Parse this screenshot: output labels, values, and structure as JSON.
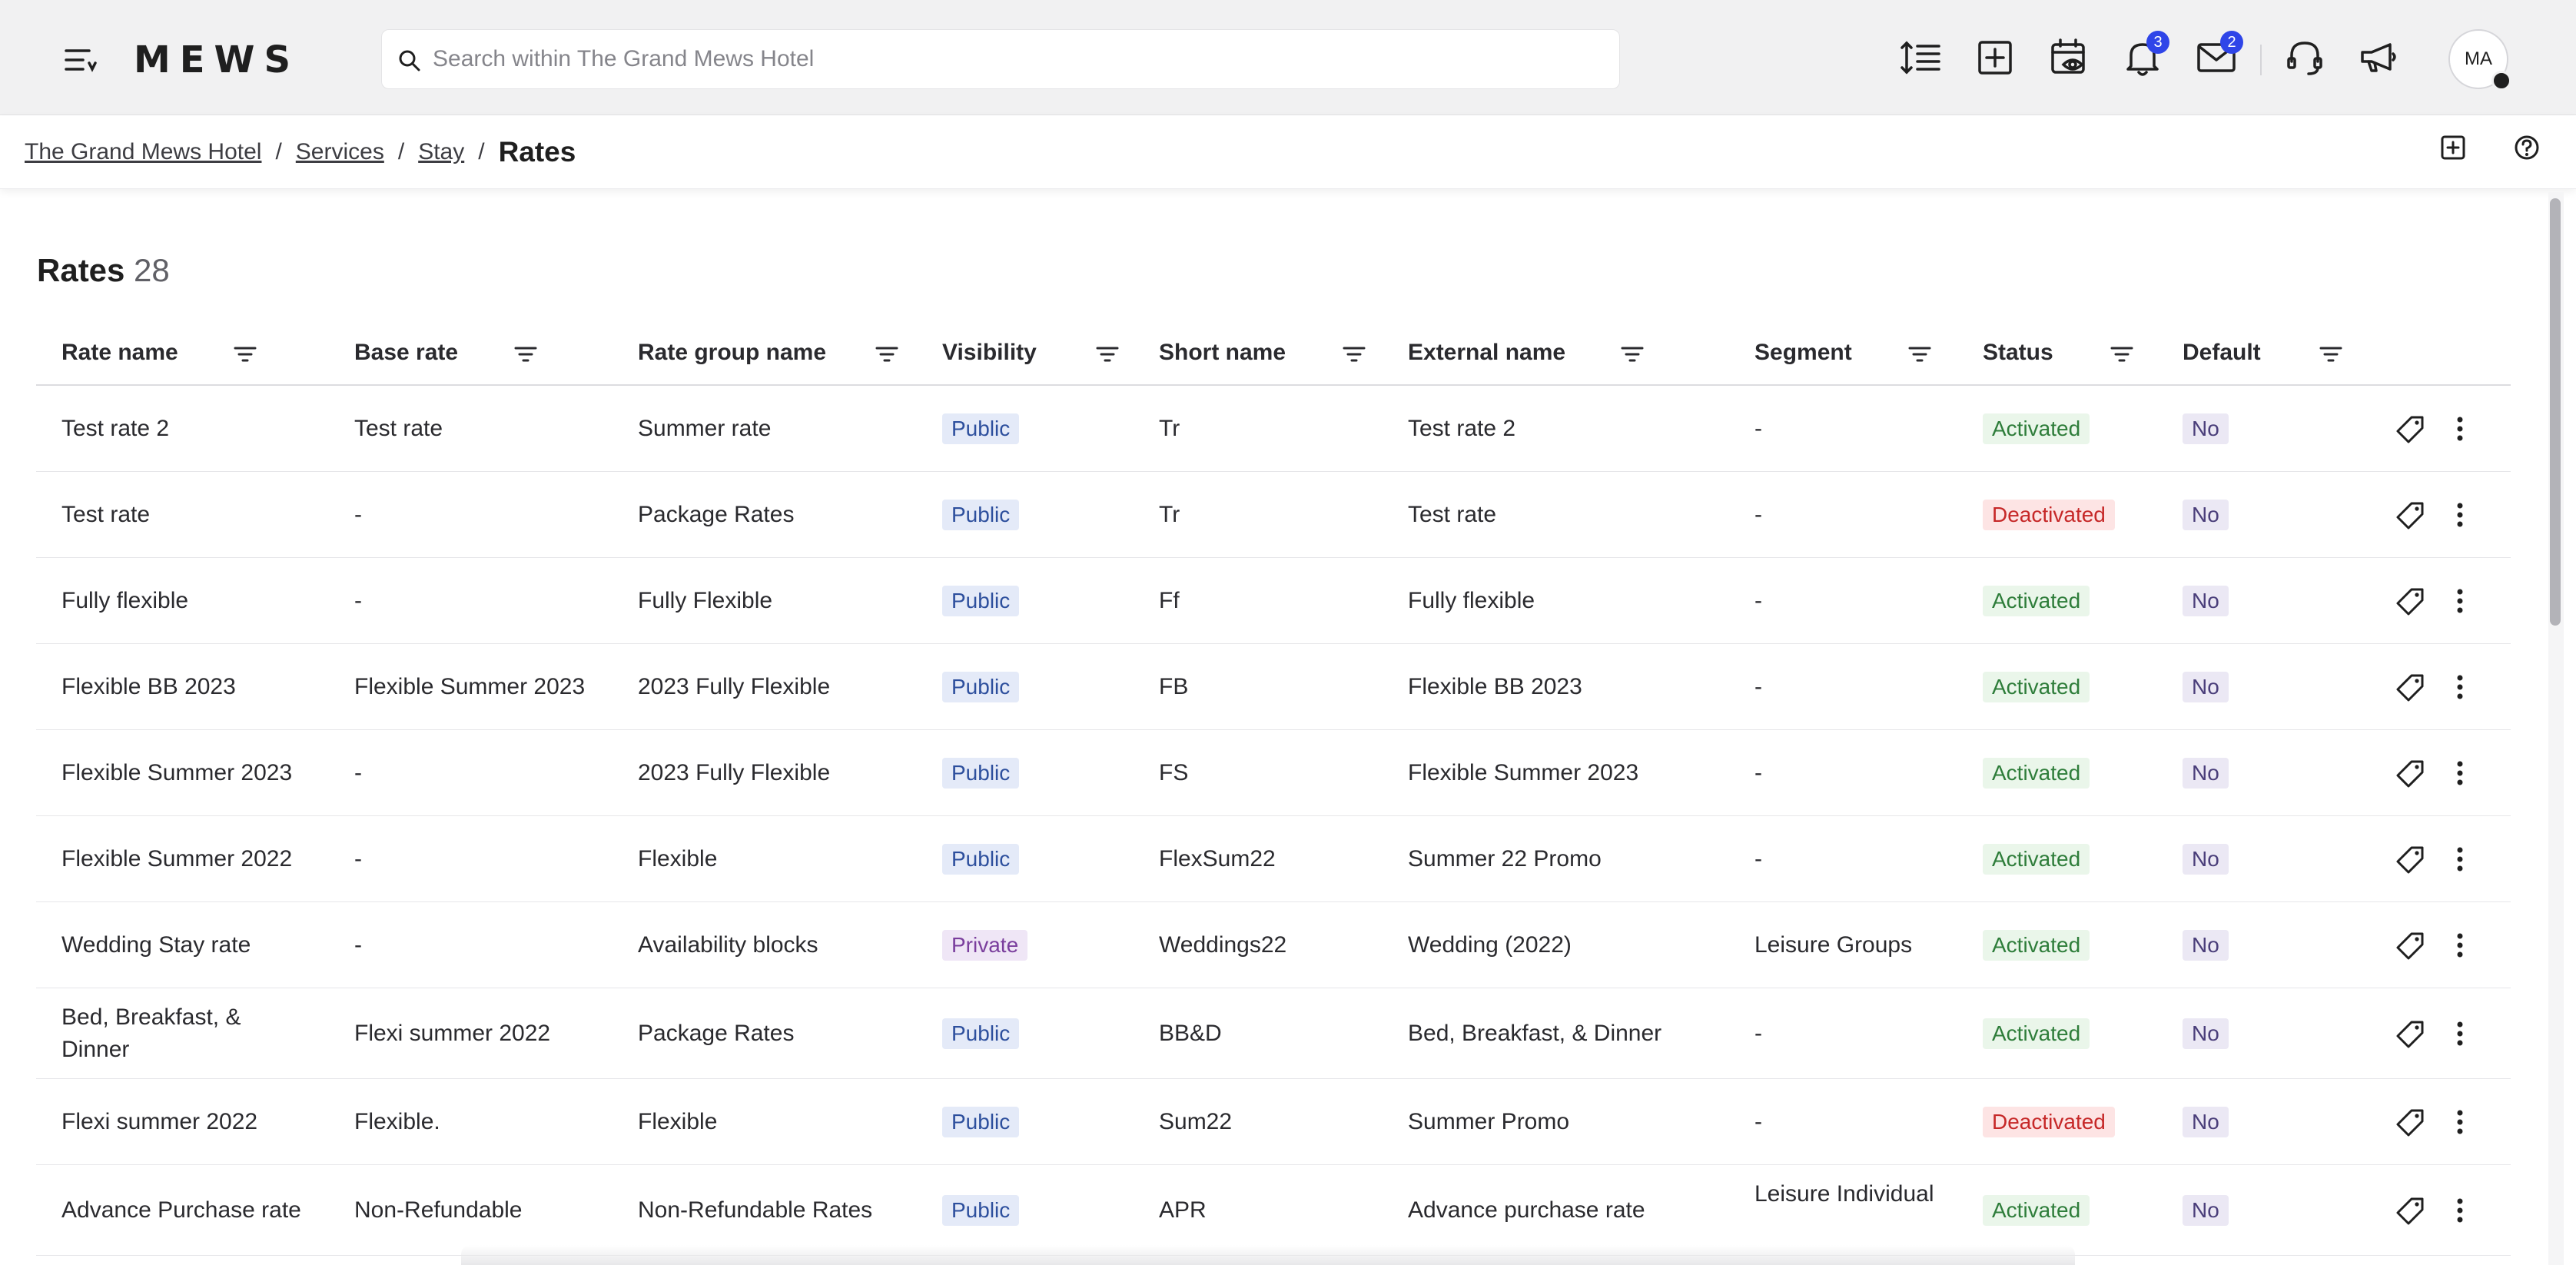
{
  "app": {
    "logo": "MEWS"
  },
  "search": {
    "placeholder": "Search within The Grand Mews Hotel"
  },
  "notifications": {
    "count": "3"
  },
  "messages": {
    "count": "2"
  },
  "user": {
    "initials": "MA"
  },
  "breadcrumb": {
    "items": [
      "The Grand Mews Hotel",
      "Services",
      "Stay"
    ],
    "current": "Rates"
  },
  "page": {
    "title": "Rates",
    "count": "28"
  },
  "table": {
    "columns": [
      "Rate name",
      "Base rate",
      "Rate group name",
      "Visibility",
      "Short name",
      "External name",
      "Segment",
      "Status",
      "Default"
    ],
    "rows": [
      {
        "rate_name": "Test rate 2",
        "base_rate": "Test rate",
        "rate_group": "Summer rate",
        "visibility": "Public",
        "short_name": "Tr",
        "external_name": "Test rate 2",
        "segment": "-",
        "status": "Activated",
        "default": "No"
      },
      {
        "rate_name": "Test rate",
        "base_rate": "-",
        "rate_group": "Package Rates",
        "visibility": "Public",
        "short_name": "Tr",
        "external_name": "Test rate",
        "segment": "-",
        "status": "Deactivated",
        "default": "No"
      },
      {
        "rate_name": "Fully flexible",
        "base_rate": "-",
        "rate_group": "Fully Flexible",
        "visibility": "Public",
        "short_name": "Ff",
        "external_name": "Fully flexible",
        "segment": "-",
        "status": "Activated",
        "default": "No"
      },
      {
        "rate_name": "Flexible BB 2023",
        "base_rate": "Flexible Summer 2023",
        "rate_group": "2023 Fully Flexible",
        "visibility": "Public",
        "short_name": "FB",
        "external_name": "Flexible BB 2023",
        "segment": "-",
        "status": "Activated",
        "default": "No"
      },
      {
        "rate_name": "Flexible Summer 2023",
        "base_rate": "-",
        "rate_group": "2023 Fully Flexible",
        "visibility": "Public",
        "short_name": "FS",
        "external_name": "Flexible Summer 2023",
        "segment": "-",
        "status": "Activated",
        "default": "No"
      },
      {
        "rate_name": "Flexible Summer 2022",
        "base_rate": "-",
        "rate_group": "Flexible",
        "visibility": "Public",
        "short_name": "FlexSum22",
        "external_name": "Summer 22 Promo",
        "segment": "-",
        "status": "Activated",
        "default": "No"
      },
      {
        "rate_name": "Wedding Stay rate",
        "base_rate": "-",
        "rate_group": "Availability blocks",
        "visibility": "Private",
        "short_name": "Weddings22",
        "external_name": "Wedding (2022)",
        "segment": "Leisure Groups",
        "status": "Activated",
        "default": "No"
      },
      {
        "rate_name": "Bed, Breakfast, & Dinner",
        "base_rate": "Flexi summer 2022",
        "rate_group": "Package Rates",
        "visibility": "Public",
        "short_name": "BB&D",
        "external_name": "Bed, Breakfast, & Dinner",
        "segment": "-",
        "status": "Activated",
        "default": "No"
      },
      {
        "rate_name": "Flexi summer 2022",
        "base_rate": "Flexible.",
        "rate_group": "Flexible",
        "visibility": "Public",
        "short_name": "Sum22",
        "external_name": "Summer Promo",
        "segment": "-",
        "status": "Deactivated",
        "default": "No"
      },
      {
        "rate_name": "Advance Purchase rate",
        "base_rate": "Non-Refundable",
        "rate_group": "Non-Refundable Rates",
        "visibility": "Public",
        "short_name": "APR",
        "external_name": "Advance purchase rate",
        "segment": "Leisure Individual",
        "status": "Activated",
        "default": "No"
      }
    ]
  },
  "colors": {
    "topbar_bg": "#f1f1f2",
    "badge": "#2f45e8",
    "activated_text": "#2e7d3a",
    "deactivated_text": "#c62828",
    "public_text": "#2d4f9d",
    "private_text": "#7a3e9d"
  },
  "icons": {
    "toolbar": [
      "sort-lines-icon",
      "add-square-icon",
      "calendar-eye-icon",
      "bell-icon",
      "mail-icon",
      "headset-icon",
      "megaphone-icon"
    ],
    "row_actions": [
      "tag-icon",
      "more-vertical-icon"
    ]
  }
}
